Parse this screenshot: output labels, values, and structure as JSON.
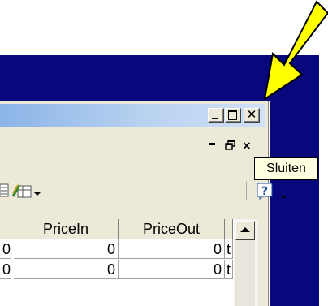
{
  "window": {
    "title_buttons": {
      "minimize_icon": "minimize-icon",
      "maximize_icon": "maximize-icon",
      "close_icon": "close-icon"
    },
    "mdi_controls": {
      "minimize_glyph": "_",
      "restore_glyph": "🗗",
      "close_glyph": "×"
    }
  },
  "toolbar": {
    "icons": [
      "document-icon",
      "pivot-icon",
      "dropdown-arrow-icon",
      "help-icon",
      "dropdown-arrow-icon"
    ]
  },
  "grid": {
    "columns": [
      "PriceIn",
      "PriceOut"
    ],
    "rows": [
      {
        "lead": "0",
        "price_in": "0",
        "price_out": "0",
        "tail": "t"
      },
      {
        "lead": "0",
        "price_in": "0",
        "price_out": "0",
        "tail": "t"
      }
    ]
  },
  "tooltip": {
    "text": "Sluiten"
  },
  "colors": {
    "desktop": "#08087c",
    "titlebar_start": "#8cb4e8",
    "titlebar_end": "#d0e0f6",
    "arrow_fill": "#ffff00",
    "tooltip_bg": "#ffffe1"
  }
}
